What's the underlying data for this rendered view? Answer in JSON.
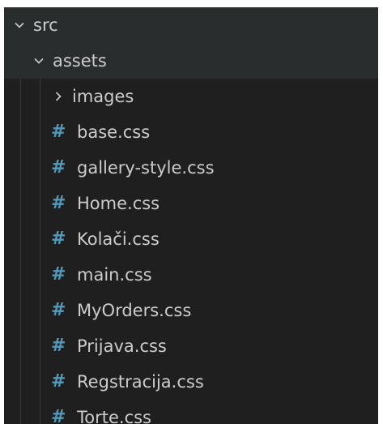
{
  "explorer": {
    "folders": {
      "src": {
        "label": "src",
        "expanded": true
      },
      "assets": {
        "label": "assets",
        "expanded": true
      },
      "images": {
        "label": "images",
        "expanded": false
      }
    },
    "file_icon": "#",
    "files": [
      {
        "label": "base.css"
      },
      {
        "label": "gallery-style.css"
      },
      {
        "label": "Home.css"
      },
      {
        "label": "Kolači.css"
      },
      {
        "label": "main.css"
      },
      {
        "label": "MyOrders.css"
      },
      {
        "label": "Prijava.css"
      },
      {
        "label": "Regstracija.css"
      },
      {
        "label": "Torte.css"
      }
    ]
  },
  "colors": {
    "background": "#1f1f1f",
    "text": "#cccccc",
    "css_icon": "#519aba",
    "selected_row": "#2a2d2e",
    "indent_guide": "#3a3a3a"
  }
}
